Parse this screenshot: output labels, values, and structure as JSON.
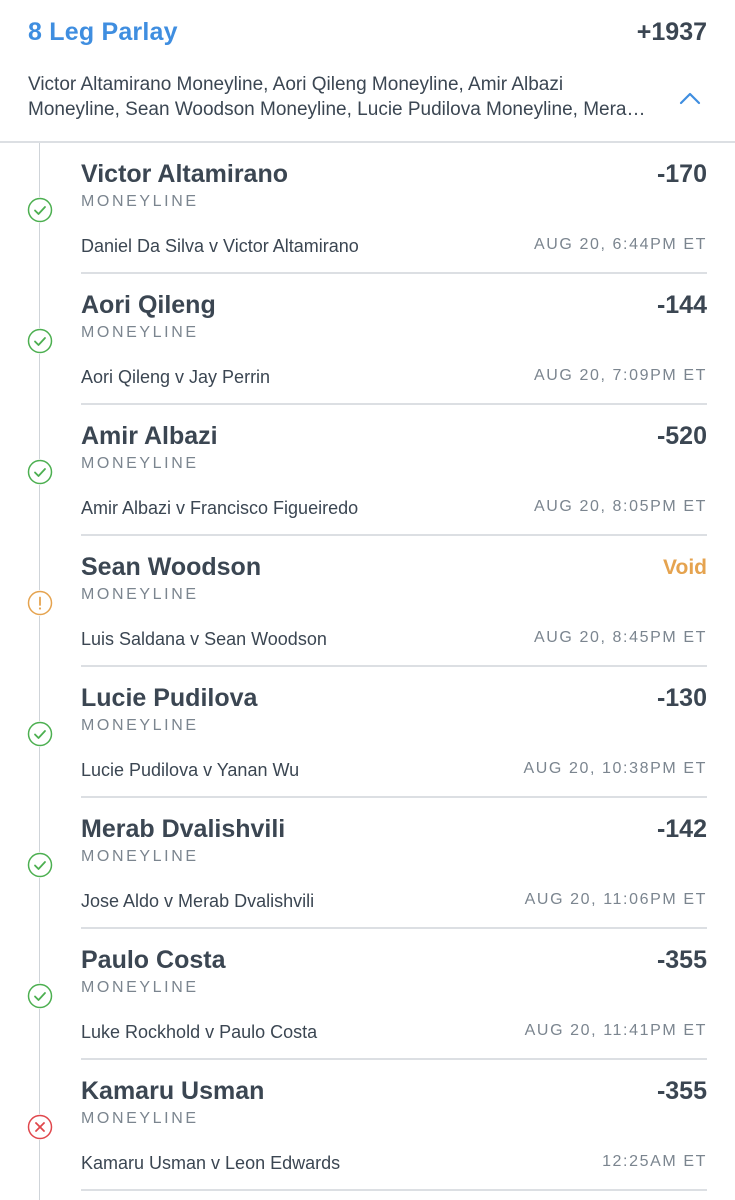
{
  "parlay": {
    "title": "8 Leg Parlay",
    "odds": "+1937",
    "summary": "Victor Altamirano Moneyline, Aori Qileng Moneyline, Amir Albazi Moneyline, Sean Woodson Moneyline, Lucie Pudilova Moneyline, Merab Dvalishvili Moneyline, Paulo Costa Moneyline, Kamaru Usman Moneyline",
    "toggle_icon": "chevron-up-icon"
  },
  "colors": {
    "accent": "#3f8ee0",
    "won": "#4caf50",
    "void": "#e5a34f",
    "lost": "#e0474c"
  },
  "legs": [
    {
      "name": "Victor Altamirano",
      "odds": "-170",
      "market": "MONEYLINE",
      "matchup": "Daniel Da Silva v Victor Altamirano",
      "time": "AUG 20, 6:44PM ET",
      "status": "won"
    },
    {
      "name": "Aori Qileng",
      "odds": "-144",
      "market": "MONEYLINE",
      "matchup": "Aori Qileng v Jay Perrin",
      "time": "AUG 20, 7:09PM ET",
      "status": "won"
    },
    {
      "name": "Amir Albazi",
      "odds": "-520",
      "market": "MONEYLINE",
      "matchup": "Amir Albazi v Francisco Figueiredo",
      "time": "AUG 20, 8:05PM ET",
      "status": "won"
    },
    {
      "name": "Sean Woodson",
      "odds": "Void",
      "market": "MONEYLINE",
      "matchup": "Luis Saldana v Sean Woodson",
      "time": "AUG 20, 8:45PM ET",
      "status": "void"
    },
    {
      "name": "Lucie Pudilova",
      "odds": "-130",
      "market": "MONEYLINE",
      "matchup": "Lucie Pudilova v Yanan Wu",
      "time": "AUG 20, 10:38PM ET",
      "status": "won"
    },
    {
      "name": "Merab Dvalishvili",
      "odds": "-142",
      "market": "MONEYLINE",
      "matchup": "Jose Aldo v Merab Dvalishvili",
      "time": "AUG 20, 11:06PM ET",
      "status": "won"
    },
    {
      "name": "Paulo Costa",
      "odds": "-355",
      "market": "MONEYLINE",
      "matchup": "Luke Rockhold v Paulo Costa",
      "time": "AUG 20, 11:41PM ET",
      "status": "won"
    },
    {
      "name": "Kamaru Usman",
      "odds": "-355",
      "market": "MONEYLINE",
      "matchup": "Kamaru Usman v Leon Edwards",
      "time": "12:25AM ET",
      "status": "lost"
    }
  ]
}
